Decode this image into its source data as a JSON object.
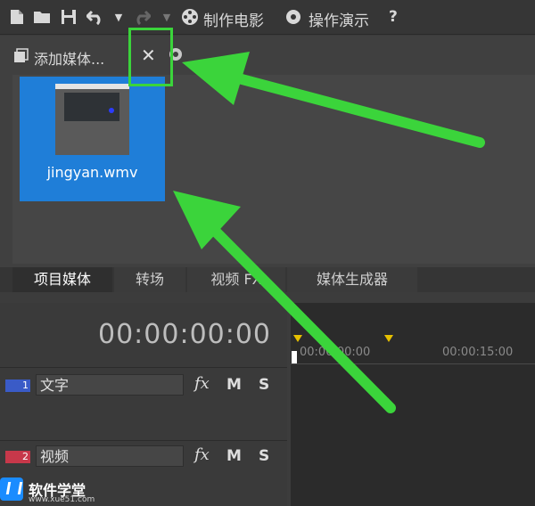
{
  "toolbar": {
    "icons": [
      "new-file-icon",
      "open-folder-icon",
      "save-icon",
      "undo-icon",
      "dropdown-icon",
      "redo-icon",
      "dropdown-icon",
      "film-reel-icon",
      "help-icon"
    ],
    "make_movie_label": "制作电影",
    "tutorial_label": "操作演示",
    "help_label": "?"
  },
  "media_panel": {
    "add_media_label": "添加媒体...",
    "close_glyph": "✕",
    "items": [
      {
        "filename": "jingyan.wmv"
      }
    ]
  },
  "tabs": [
    {
      "label": "项目媒体",
      "active": true
    },
    {
      "label": "转场",
      "active": false
    },
    {
      "label": "视频 FX",
      "active": false
    },
    {
      "label": "媒体生成器",
      "active": false
    }
  ],
  "timeline": {
    "timecode": "00:00:00:00",
    "ruler": [
      "00:00:00:00",
      "00:00:15:00"
    ],
    "tracks": [
      {
        "number": "1",
        "name": "文字",
        "icon": "text-track-icon",
        "color": "#3a5bc7",
        "fx": "fx",
        "mute": "M",
        "solo": "S"
      },
      {
        "number": "2",
        "name": "视频",
        "icon": "video-track-icon",
        "color": "#c7384a",
        "fx": "fx",
        "mute": "M",
        "solo": "S"
      }
    ]
  },
  "annotations": {
    "highlight_color": "#3bd43b",
    "arrow_color": "#3bd43b"
  },
  "watermark": {
    "name": "软件学堂",
    "url": "www.xue51.com"
  }
}
